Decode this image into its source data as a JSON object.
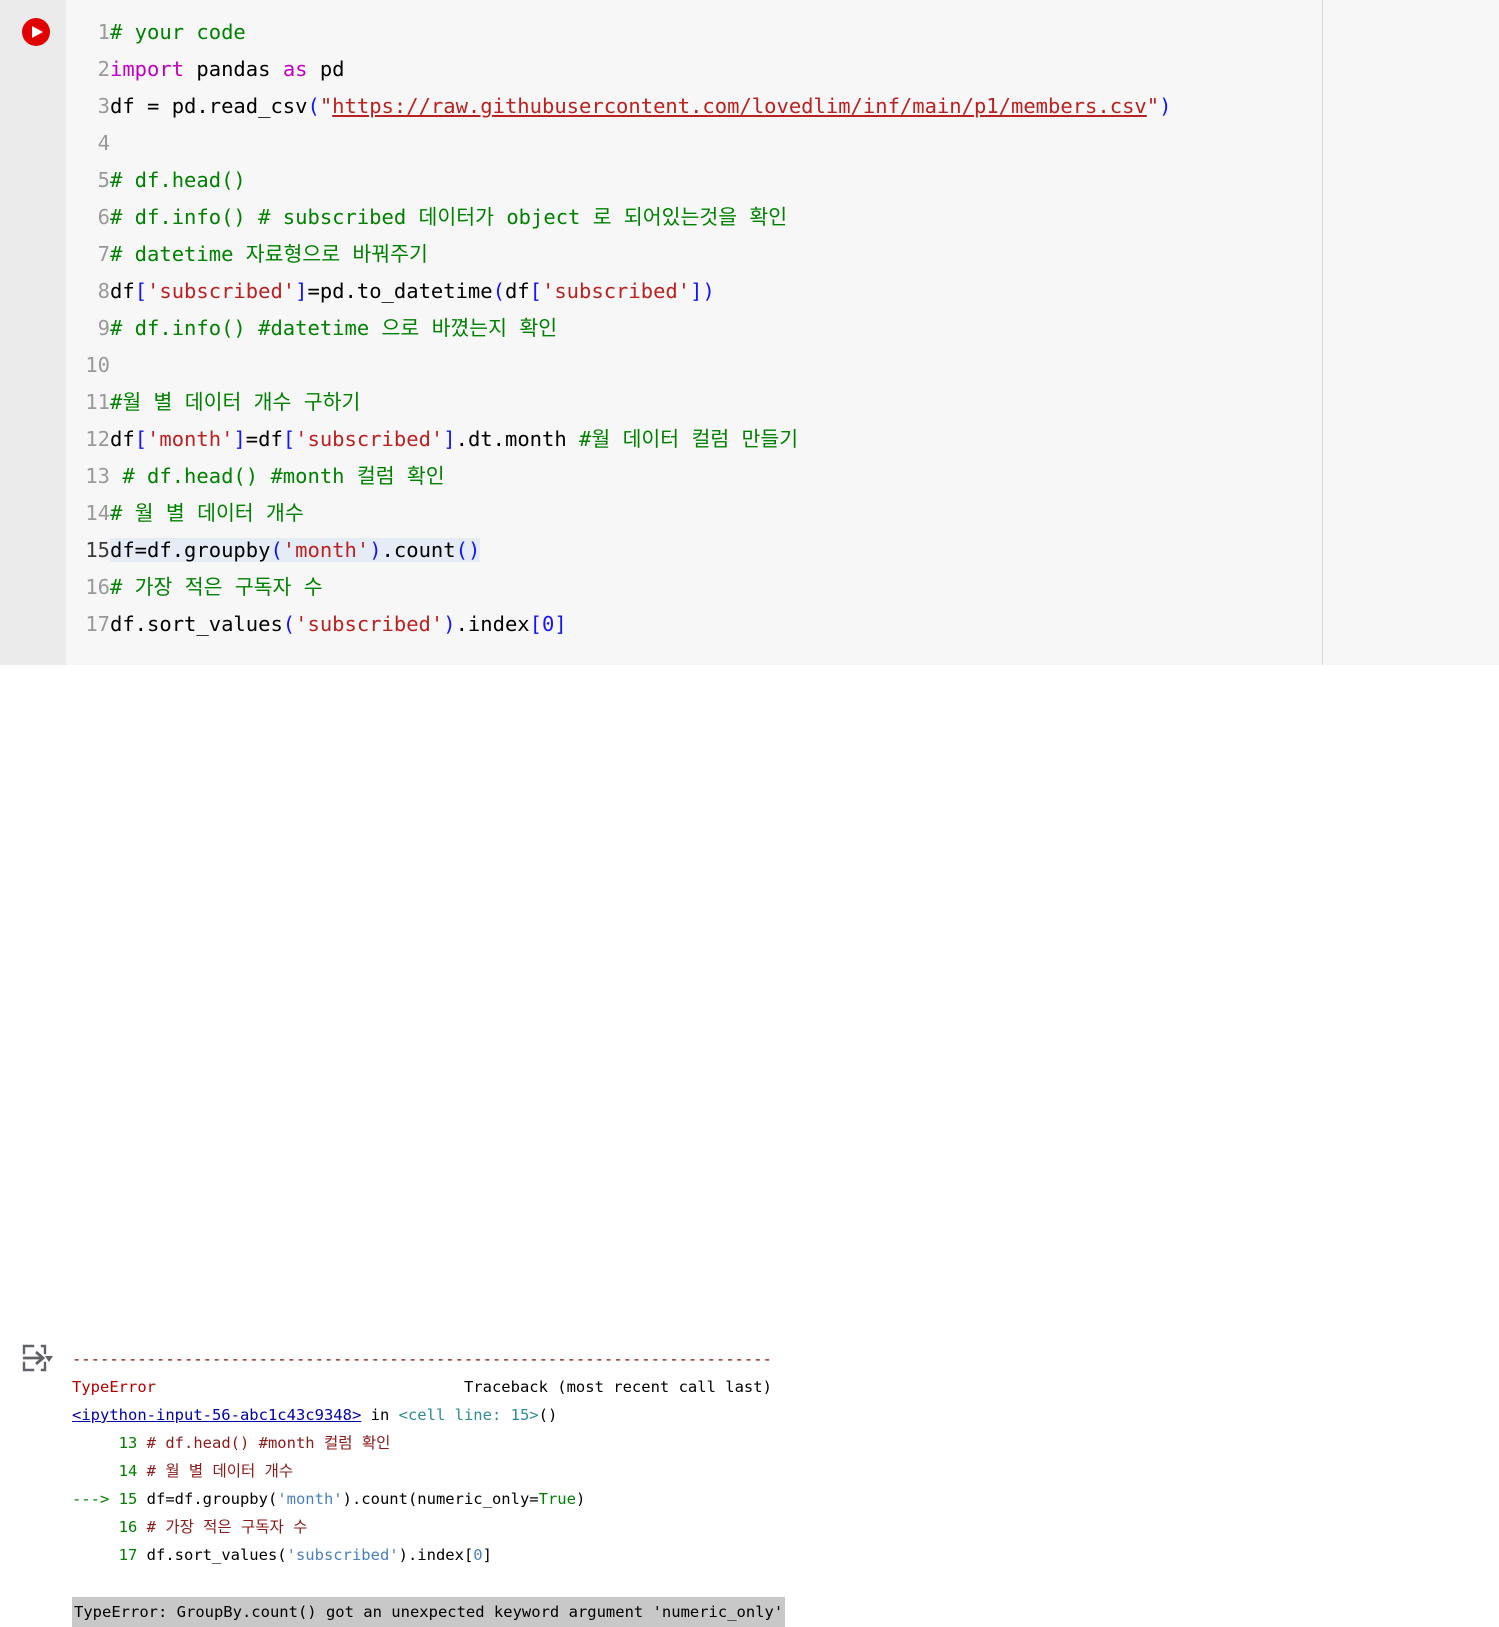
{
  "notebook": {
    "run_button": {
      "name": "run-cell",
      "color": "#e00000"
    },
    "output_icon": {
      "name": "output-insert-arrow"
    }
  },
  "code_cell": {
    "highlighted_line": 15,
    "lines": [
      {
        "n": "1",
        "tokens": [
          {
            "t": "com",
            "v": "# your code"
          }
        ]
      },
      {
        "n": "2",
        "tokens": [
          {
            "t": "kw",
            "v": "import"
          },
          {
            "t": "pln",
            "v": " pandas "
          },
          {
            "t": "kw",
            "v": "as"
          },
          {
            "t": "pln",
            "v": " pd"
          }
        ]
      },
      {
        "n": "3",
        "tokens": [
          {
            "t": "pln",
            "v": "df = pd.read_csv"
          },
          {
            "t": "brk",
            "v": "("
          },
          {
            "t": "str",
            "v": "\""
          },
          {
            "t": "lnk",
            "v": "https://raw.githubusercontent.com/lovedlim/inf/main/p1/members.csv"
          },
          {
            "t": "str",
            "v": "\""
          },
          {
            "t": "brk",
            "v": ")"
          }
        ]
      },
      {
        "n": "4",
        "tokens": []
      },
      {
        "n": "5",
        "tokens": [
          {
            "t": "com",
            "v": "# df.head()"
          }
        ]
      },
      {
        "n": "6",
        "tokens": [
          {
            "t": "com",
            "v": "# df.info() # subscribed 데이터가 object 로 되어있는것을 확인"
          }
        ]
      },
      {
        "n": "7",
        "tokens": [
          {
            "t": "com",
            "v": "# datetime 자료형으로 바꿔주기"
          }
        ]
      },
      {
        "n": "8",
        "tokens": [
          {
            "t": "pln",
            "v": "df"
          },
          {
            "t": "brk",
            "v": "["
          },
          {
            "t": "str",
            "v": "'subscribed'"
          },
          {
            "t": "brk",
            "v": "]"
          },
          {
            "t": "pln",
            "v": "=pd.to_datetime"
          },
          {
            "t": "brk",
            "v": "("
          },
          {
            "t": "pln",
            "v": "df"
          },
          {
            "t": "brk",
            "v": "["
          },
          {
            "t": "str",
            "v": "'subscribed'"
          },
          {
            "t": "brk",
            "v": "])"
          }
        ]
      },
      {
        "n": "9",
        "tokens": [
          {
            "t": "com",
            "v": "# df.info() #datetime 으로 바꼈는지 확인"
          }
        ]
      },
      {
        "n": "10",
        "tokens": []
      },
      {
        "n": "11",
        "tokens": [
          {
            "t": "com",
            "v": "#월 별 데이터 개수 구하기"
          }
        ]
      },
      {
        "n": "12",
        "tokens": [
          {
            "t": "pln",
            "v": "df"
          },
          {
            "t": "brk",
            "v": "["
          },
          {
            "t": "str",
            "v": "'month'"
          },
          {
            "t": "brk",
            "v": "]"
          },
          {
            "t": "pln",
            "v": "=df"
          },
          {
            "t": "brk",
            "v": "["
          },
          {
            "t": "str",
            "v": "'subscribed'"
          },
          {
            "t": "brk",
            "v": "]"
          },
          {
            "t": "pln",
            "v": ".dt.month "
          },
          {
            "t": "com",
            "v": "#월 데이터 컬럼 만들기"
          }
        ]
      },
      {
        "n": "13",
        "tokens": [
          {
            "t": "com",
            "v": " # df.head() #month 컬럼 확인"
          }
        ]
      },
      {
        "n": "14",
        "tokens": [
          {
            "t": "com",
            "v": "# 월 별 데이터 개수"
          }
        ]
      },
      {
        "n": "15",
        "tokens": [
          {
            "t": "pln",
            "v": "df=df.groupby"
          },
          {
            "t": "brk",
            "v": "("
          },
          {
            "t": "str",
            "v": "'month'"
          },
          {
            "t": "brk",
            "v": ")"
          },
          {
            "t": "pln",
            "v": ".count"
          },
          {
            "t": "brk",
            "v": "()"
          }
        ]
      },
      {
        "n": "16",
        "tokens": [
          {
            "t": "com",
            "v": "# 가장 적은 구독자 수"
          }
        ]
      },
      {
        "n": "17",
        "tokens": [
          {
            "t": "pln",
            "v": "df.sort_values"
          },
          {
            "t": "brk",
            "v": "("
          },
          {
            "t": "str",
            "v": "'subscribed'"
          },
          {
            "t": "brk",
            "v": ")"
          },
          {
            "t": "pln",
            "v": ".index"
          },
          {
            "t": "num",
            "v": "[0]"
          }
        ]
      }
    ]
  },
  "output": {
    "separator": "---------------------------------------------------------------------------",
    "header": {
      "error_type": "TypeError",
      "traceback_label": "Traceback (most recent call last)"
    },
    "frame": {
      "ref": "<ipython-input-56-abc1c43c9348>",
      "in_word": " in ",
      "cell": "<cell line: 15>",
      "parens": "()"
    },
    "frame_lines": [
      {
        "arrow": "    ",
        "n": " 13",
        "tokens": [
          {
            "t": "comment",
            "v": " # df.head() #month 컬럼 확인"
          }
        ]
      },
      {
        "arrow": "    ",
        "n": " 14",
        "tokens": [
          {
            "t": "comment",
            "v": " # 월 별 데이터 개수"
          }
        ]
      },
      {
        "arrow": "--->",
        "n": " 15",
        "tokens": [
          {
            "t": "blk",
            "v": " df=df.groupby("
          },
          {
            "t": "str",
            "v": "'month'"
          },
          {
            "t": "blk",
            "v": ").count(numeric_only="
          },
          {
            "t": "kw",
            "v": "True"
          },
          {
            "t": "blk",
            "v": ")"
          }
        ]
      },
      {
        "arrow": "    ",
        "n": " 16",
        "tokens": [
          {
            "t": "comment",
            "v": " # 가장 적은 구독자 수"
          }
        ]
      },
      {
        "arrow": "    ",
        "n": " 17",
        "tokens": [
          {
            "t": "blk",
            "v": " df.sort_values("
          },
          {
            "t": "str",
            "v": "'subscribed'"
          },
          {
            "t": "blk",
            "v": ").index["
          },
          {
            "t": "str",
            "v": "0"
          },
          {
            "t": "blk",
            "v": "]"
          }
        ]
      }
    ],
    "final_error": "TypeError: GroupBy.count() got an unexpected keyword argument 'numeric_only'"
  }
}
